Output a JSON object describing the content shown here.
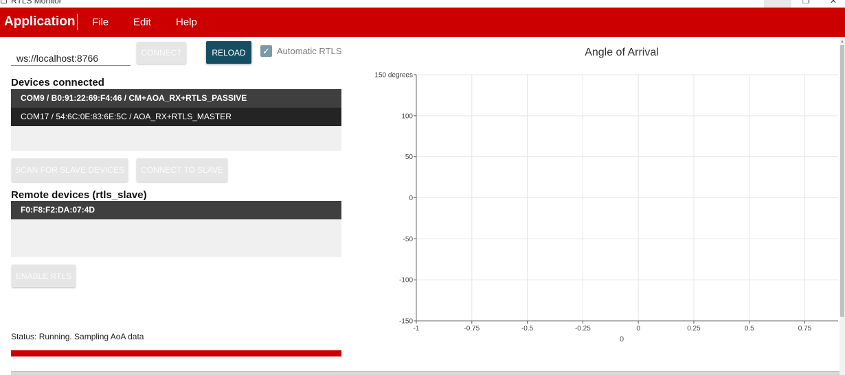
{
  "window": {
    "title": "RTLS Monitor",
    "controls": {
      "minimize": "–",
      "maximize": "❐",
      "close": "✕"
    }
  },
  "appbar": {
    "brand": "Application",
    "menu": [
      "File",
      "Edit",
      "Help"
    ],
    "color": "#cc0000"
  },
  "connection": {
    "url": "ws://localhost:8766",
    "connect_label": "CONNECT",
    "reload_label": "RELOAD",
    "auto_rtls_label": "Automatic RTLS",
    "auto_rtls_checked": true
  },
  "devices": {
    "title": "Devices connected",
    "items": [
      "COM9 / B0:91:22:69:F4:46 / CM+AOA_RX+RTLS_PASSIVE",
      "COM17 / 54:6C:0E:83:6E:5C / AOA_RX+RTLS_MASTER"
    ],
    "scan_label": "SCAN FOR SLAVE DEVICES",
    "connect_slave_label": "CONNECT TO SLAVE"
  },
  "remote": {
    "title": "Remote devices (rtls_slave)",
    "items": [
      "F0:F8:F2:DA:07:4D"
    ],
    "enable_label": "ENABLE RTLS"
  },
  "status": {
    "text": "Status: Running. Sampling AoA data",
    "progress": 1.0
  },
  "chart_data": {
    "type": "scatter",
    "title": "Angle of Arrival",
    "xlabel": "0",
    "ylabel": "",
    "xlim": [
      -1,
      0.9
    ],
    "ylim": [
      -150,
      150
    ],
    "x_ticks": [
      -1,
      -0.75,
      -0.5,
      -0.25,
      0,
      0.25,
      0.5,
      0.75
    ],
    "x_tick_labels": [
      "-1",
      "-0.75",
      "-0.5",
      "-0.25",
      "0",
      "0.25",
      "0.5",
      "0.75"
    ],
    "y_ticks": [
      150,
      100,
      50,
      0,
      -50,
      -100,
      -150
    ],
    "y_tick_labels": [
      "150 degrees",
      "100",
      "50",
      "0",
      "-50",
      "-100",
      "-150"
    ],
    "grid": true,
    "series": []
  }
}
